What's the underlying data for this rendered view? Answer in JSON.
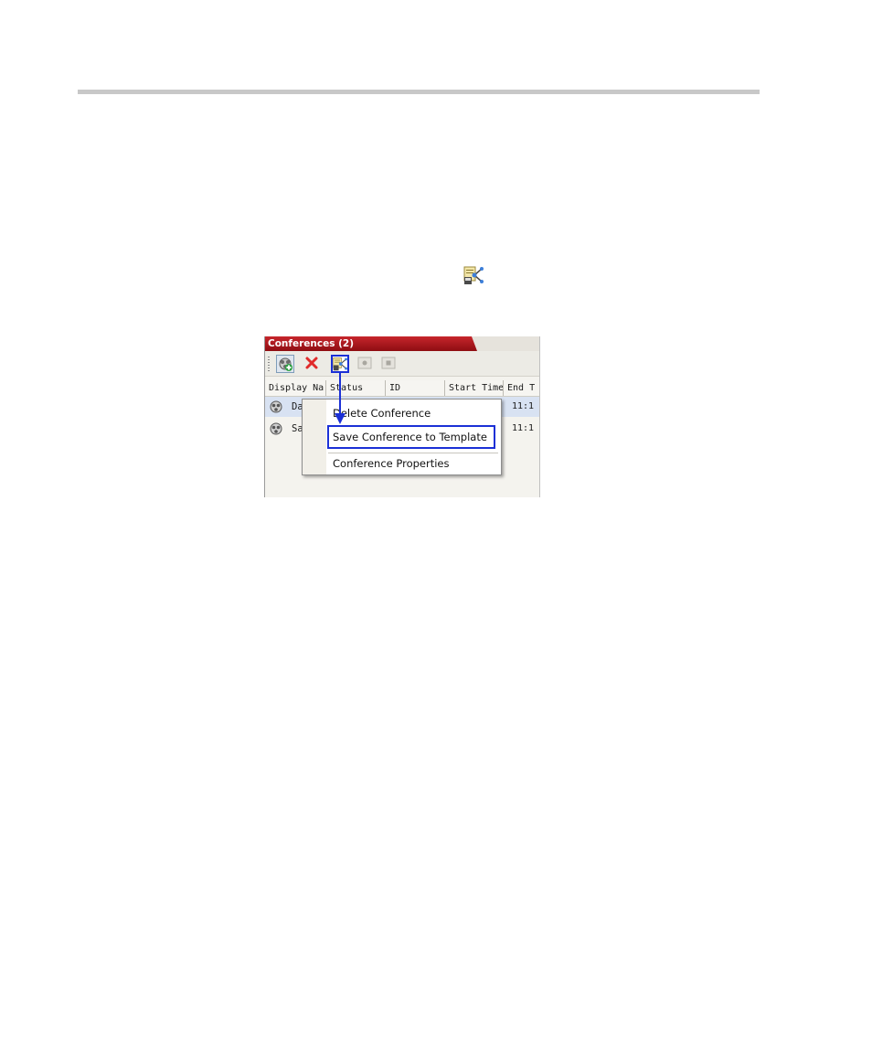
{
  "panel": {
    "title": "Conferences (2)",
    "toolbar": [
      {
        "name": "new-conference-icon"
      },
      {
        "name": "delete-icon"
      },
      {
        "name": "save-to-template-icon"
      },
      {
        "name": "record-icon"
      },
      {
        "name": "stop-icon"
      }
    ],
    "columns": [
      "Display Na",
      "Status",
      "ID",
      "Start Time",
      "End T"
    ],
    "rows": [
      {
        "name": "Da",
        "end": "11:1",
        "selected": true
      },
      {
        "name": "Sa",
        "end": "11:1",
        "selected": false
      }
    ]
  },
  "context_menu": {
    "items": [
      "Delete Conference",
      "Save Conference to Template",
      "Conference Properties"
    ],
    "highlighted_index": 1
  },
  "colors": {
    "title_bar": "#b31b21",
    "highlight_box": "#1b30d6",
    "selected_row": "#d8e2f2"
  }
}
